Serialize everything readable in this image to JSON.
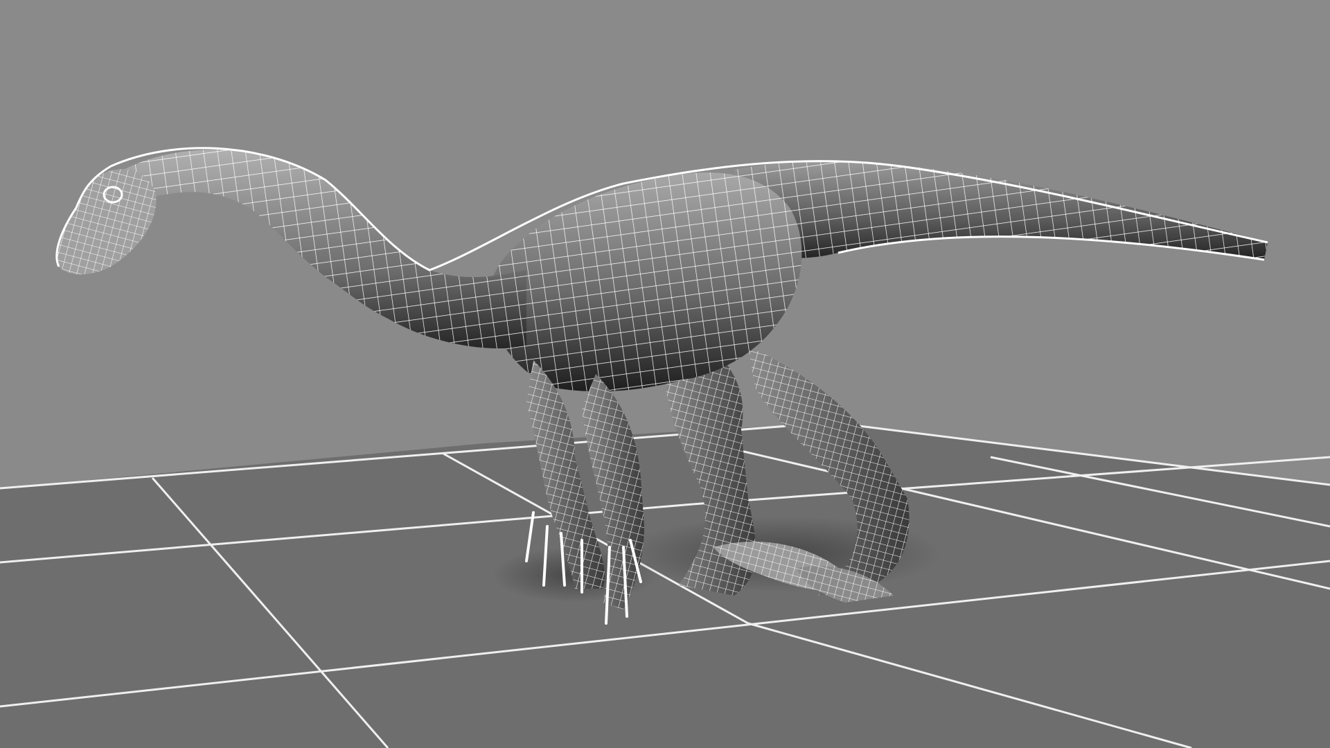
{
  "scene": {
    "subject": "wireframe-dinosaur-model",
    "display_mode": "wireframe-on-shaded",
    "colors": {
      "background": "#8a8a8a",
      "ground": "#6f6f6f",
      "grid_lines": "#f2f2f2",
      "mesh_wire": "#ffffff",
      "mesh_shade_light": "#a6a6a6",
      "mesh_shade_dark": "#1f1f1f"
    },
    "grid": {
      "visible": true
    },
    "mesh": {
      "visible": true
    }
  }
}
